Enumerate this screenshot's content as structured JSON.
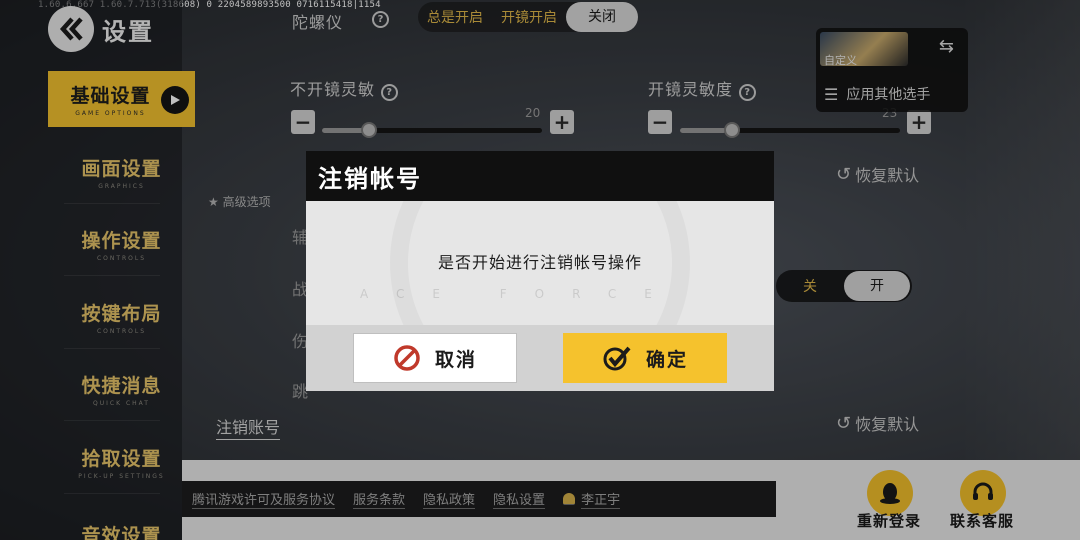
{
  "debug": "1.60.6.667  1.60.7.713(318608)  0  2204589893500    0716115418|1154",
  "sidebar": {
    "title": "设置",
    "items": [
      {
        "zh": "基础设置",
        "en": "GAME OPTIONS"
      },
      {
        "zh": "画面设置",
        "en": "GRAPHICS"
      },
      {
        "zh": "操作设置",
        "en": "CONTROLS"
      },
      {
        "zh": "按键布局",
        "en": "CONTROLS"
      },
      {
        "zh": "快捷消息",
        "en": "QUICK CHAT"
      },
      {
        "zh": "拾取设置",
        "en": "PICK-UP SETTINGS"
      },
      {
        "zh": "音效设置",
        "en": ""
      }
    ]
  },
  "gyro": {
    "label": "陀螺仪",
    "options": [
      "总是开启",
      "开镜开启",
      "关闭"
    ]
  },
  "sensitivity": {
    "no_scope_label": "不开镜灵敏",
    "no_scope_value": "20",
    "scope_label": "开镜灵敏度",
    "scope_value": "23"
  },
  "card": {
    "custom_label": "自定义",
    "apply_label": "应用其他选手"
  },
  "restore_label": "恢复默认",
  "advanced_label": "高级选项",
  "partial_labels": [
    "辅",
    "战",
    "伤",
    "跳"
  ],
  "toggle": {
    "off": "关",
    "on": "开"
  },
  "logout_link": "注销账号",
  "legal": {
    "links": [
      "腾讯游戏许可及服务协议",
      "服务条款",
      "隐私政策",
      "隐私设置"
    ],
    "user": "李正宇"
  },
  "actions": {
    "relogin": "重新登录",
    "support": "联系客服"
  },
  "modal": {
    "title": "注销帐号",
    "message": "是否开始进行注销帐号操作",
    "watermark": "ACE FORCE",
    "cancel": "取消",
    "confirm": "确定"
  },
  "colors": {
    "accent": "#f3c22f",
    "gold_text": "#e7c56a"
  }
}
